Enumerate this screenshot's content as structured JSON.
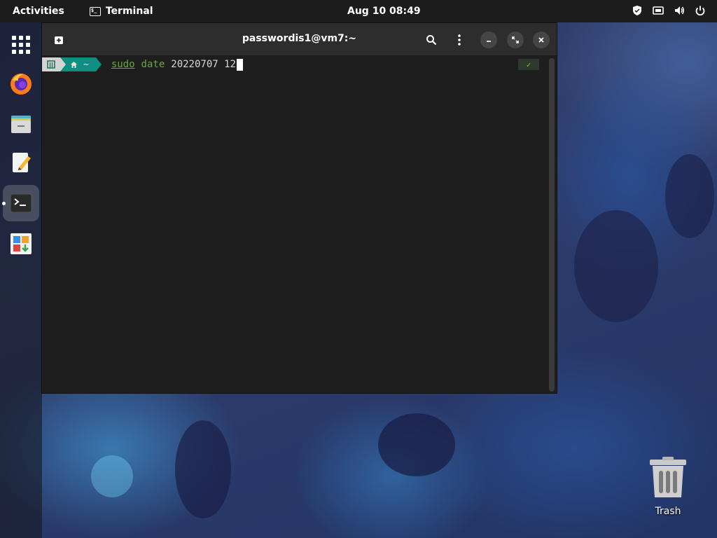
{
  "topbar": {
    "activities": "Activities",
    "app_name": "Terminal",
    "app_icon_text": "$_",
    "clock": "Aug 10  08:49"
  },
  "dock": {
    "items": [
      {
        "name": "app-grid",
        "icon": "grid-icon"
      },
      {
        "name": "firefox",
        "icon": "firefox-icon"
      },
      {
        "name": "files",
        "icon": "files-icon"
      },
      {
        "name": "text-editor",
        "icon": "text-editor-icon"
      },
      {
        "name": "terminal",
        "icon": "terminal-icon",
        "active": true
      },
      {
        "name": "software",
        "icon": "software-icon"
      }
    ]
  },
  "window": {
    "title": "passwordis1@vm7:~",
    "prompt": {
      "dir": "~",
      "command": "sudo",
      "subcommand": "date",
      "args": "20220707 12",
      "status": "✓"
    }
  },
  "desktop": {
    "trash_label": "Trash"
  },
  "colors": {
    "topbar": "#1c1c1c",
    "terminal_bg": "#1e1e1e",
    "titlebar_bg": "#2d2d2d",
    "prompt_dir_bg": "#0e8f82",
    "command_green": "#6aa83a"
  }
}
